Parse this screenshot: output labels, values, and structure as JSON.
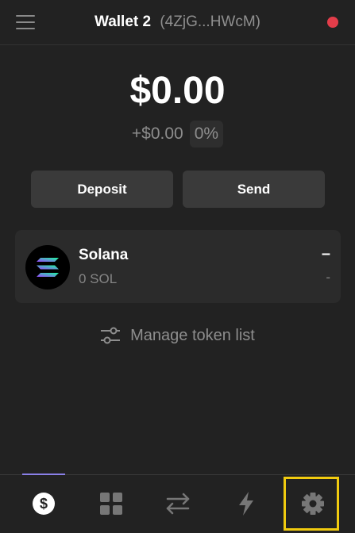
{
  "header": {
    "wallet_name": "Wallet 2",
    "wallet_address": "(4ZjG...HWcM)",
    "menu_icon": "hamburger-menu-icon",
    "status_color": "#e33d4a"
  },
  "balance": {
    "total": "$0.00",
    "change_amount": "+$0.00",
    "change_percent": "0%"
  },
  "actions": {
    "deposit_label": "Deposit",
    "send_label": "Send"
  },
  "tokens": [
    {
      "name": "Solana",
      "balance": "0 SOL",
      "usd_value": "–",
      "change": "-",
      "icon": "solana-logo-icon"
    }
  ],
  "manage_tokens": {
    "label": "Manage token list",
    "icon": "sliders-icon"
  },
  "nav": {
    "items": [
      {
        "name": "wallet",
        "icon": "dollar-circle-icon",
        "active": true
      },
      {
        "name": "collectibles",
        "icon": "grid-icon",
        "active": false
      },
      {
        "name": "swap",
        "icon": "swap-arrows-icon",
        "active": false
      },
      {
        "name": "activity",
        "icon": "lightning-icon",
        "active": false
      },
      {
        "name": "settings",
        "icon": "gear-icon",
        "active": false
      }
    ],
    "accent_color": "#8a80e8",
    "highlight_color": "#f1cb0f"
  }
}
